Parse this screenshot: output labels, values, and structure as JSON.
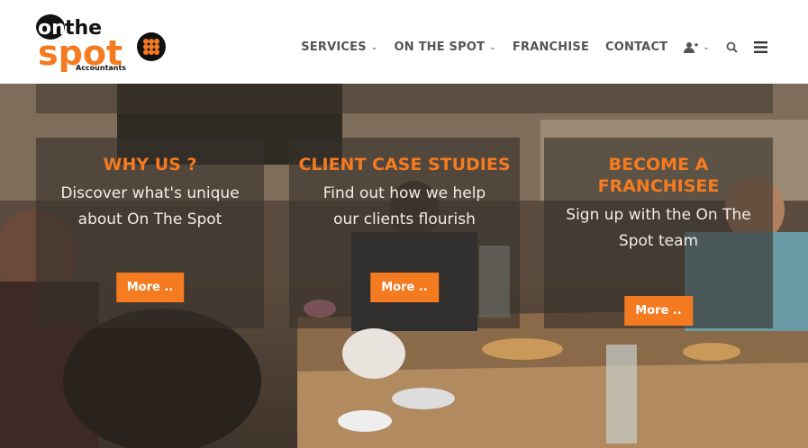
{
  "logo": {
    "line1": "on",
    "line2": "the",
    "line3": "spot",
    "sub": "Accountants"
  },
  "nav": {
    "services": "SERVICES",
    "on_the_spot": "ON THE SPOT",
    "franchise": "FRANCHISE",
    "contact": "CONTACT"
  },
  "cards": [
    {
      "title": "WHY US ?",
      "text": "Discover what's unique about On The Spot",
      "button": "More .."
    },
    {
      "title": "CLIENT CASE STUDIES",
      "text": "Find out how we help our clients flourish",
      "button": "More .."
    },
    {
      "title": "BECOME A FRANCHISEE",
      "text": "Sign up with the On The Spot team",
      "button": "More .."
    }
  ],
  "colors": {
    "accent": "#f47b20",
    "nav_text": "#555555"
  }
}
